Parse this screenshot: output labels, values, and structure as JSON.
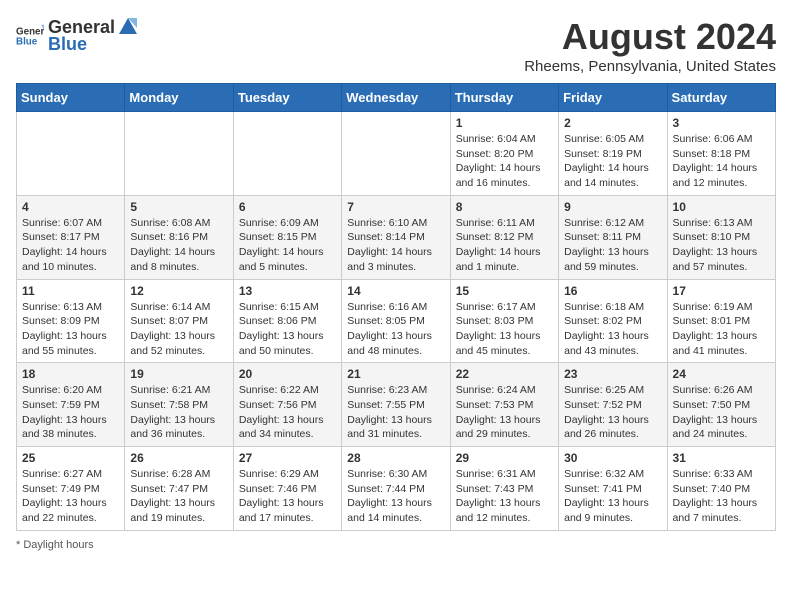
{
  "header": {
    "logo_general": "General",
    "logo_blue": "Blue",
    "month_year": "August 2024",
    "location": "Rheems, Pennsylvania, United States"
  },
  "days_of_week": [
    "Sunday",
    "Monday",
    "Tuesday",
    "Wednesday",
    "Thursday",
    "Friday",
    "Saturday"
  ],
  "weeks": [
    [
      {
        "day": "",
        "info": ""
      },
      {
        "day": "",
        "info": ""
      },
      {
        "day": "",
        "info": ""
      },
      {
        "day": "",
        "info": ""
      },
      {
        "day": "1",
        "info": "Sunrise: 6:04 AM\nSunset: 8:20 PM\nDaylight: 14 hours and 16 minutes."
      },
      {
        "day": "2",
        "info": "Sunrise: 6:05 AM\nSunset: 8:19 PM\nDaylight: 14 hours and 14 minutes."
      },
      {
        "day": "3",
        "info": "Sunrise: 6:06 AM\nSunset: 8:18 PM\nDaylight: 14 hours and 12 minutes."
      }
    ],
    [
      {
        "day": "4",
        "info": "Sunrise: 6:07 AM\nSunset: 8:17 PM\nDaylight: 14 hours and 10 minutes."
      },
      {
        "day": "5",
        "info": "Sunrise: 6:08 AM\nSunset: 8:16 PM\nDaylight: 14 hours and 8 minutes."
      },
      {
        "day": "6",
        "info": "Sunrise: 6:09 AM\nSunset: 8:15 PM\nDaylight: 14 hours and 5 minutes."
      },
      {
        "day": "7",
        "info": "Sunrise: 6:10 AM\nSunset: 8:14 PM\nDaylight: 14 hours and 3 minutes."
      },
      {
        "day": "8",
        "info": "Sunrise: 6:11 AM\nSunset: 8:12 PM\nDaylight: 14 hours and 1 minute."
      },
      {
        "day": "9",
        "info": "Sunrise: 6:12 AM\nSunset: 8:11 PM\nDaylight: 13 hours and 59 minutes."
      },
      {
        "day": "10",
        "info": "Sunrise: 6:13 AM\nSunset: 8:10 PM\nDaylight: 13 hours and 57 minutes."
      }
    ],
    [
      {
        "day": "11",
        "info": "Sunrise: 6:13 AM\nSunset: 8:09 PM\nDaylight: 13 hours and 55 minutes."
      },
      {
        "day": "12",
        "info": "Sunrise: 6:14 AM\nSunset: 8:07 PM\nDaylight: 13 hours and 52 minutes."
      },
      {
        "day": "13",
        "info": "Sunrise: 6:15 AM\nSunset: 8:06 PM\nDaylight: 13 hours and 50 minutes."
      },
      {
        "day": "14",
        "info": "Sunrise: 6:16 AM\nSunset: 8:05 PM\nDaylight: 13 hours and 48 minutes."
      },
      {
        "day": "15",
        "info": "Sunrise: 6:17 AM\nSunset: 8:03 PM\nDaylight: 13 hours and 45 minutes."
      },
      {
        "day": "16",
        "info": "Sunrise: 6:18 AM\nSunset: 8:02 PM\nDaylight: 13 hours and 43 minutes."
      },
      {
        "day": "17",
        "info": "Sunrise: 6:19 AM\nSunset: 8:01 PM\nDaylight: 13 hours and 41 minutes."
      }
    ],
    [
      {
        "day": "18",
        "info": "Sunrise: 6:20 AM\nSunset: 7:59 PM\nDaylight: 13 hours and 38 minutes."
      },
      {
        "day": "19",
        "info": "Sunrise: 6:21 AM\nSunset: 7:58 PM\nDaylight: 13 hours and 36 minutes."
      },
      {
        "day": "20",
        "info": "Sunrise: 6:22 AM\nSunset: 7:56 PM\nDaylight: 13 hours and 34 minutes."
      },
      {
        "day": "21",
        "info": "Sunrise: 6:23 AM\nSunset: 7:55 PM\nDaylight: 13 hours and 31 minutes."
      },
      {
        "day": "22",
        "info": "Sunrise: 6:24 AM\nSunset: 7:53 PM\nDaylight: 13 hours and 29 minutes."
      },
      {
        "day": "23",
        "info": "Sunrise: 6:25 AM\nSunset: 7:52 PM\nDaylight: 13 hours and 26 minutes."
      },
      {
        "day": "24",
        "info": "Sunrise: 6:26 AM\nSunset: 7:50 PM\nDaylight: 13 hours and 24 minutes."
      }
    ],
    [
      {
        "day": "25",
        "info": "Sunrise: 6:27 AM\nSunset: 7:49 PM\nDaylight: 13 hours and 22 minutes."
      },
      {
        "day": "26",
        "info": "Sunrise: 6:28 AM\nSunset: 7:47 PM\nDaylight: 13 hours and 19 minutes."
      },
      {
        "day": "27",
        "info": "Sunrise: 6:29 AM\nSunset: 7:46 PM\nDaylight: 13 hours and 17 minutes."
      },
      {
        "day": "28",
        "info": "Sunrise: 6:30 AM\nSunset: 7:44 PM\nDaylight: 13 hours and 14 minutes."
      },
      {
        "day": "29",
        "info": "Sunrise: 6:31 AM\nSunset: 7:43 PM\nDaylight: 13 hours and 12 minutes."
      },
      {
        "day": "30",
        "info": "Sunrise: 6:32 AM\nSunset: 7:41 PM\nDaylight: 13 hours and 9 minutes."
      },
      {
        "day": "31",
        "info": "Sunrise: 6:33 AM\nSunset: 7:40 PM\nDaylight: 13 hours and 7 minutes."
      }
    ]
  ],
  "footer": {
    "note": "Daylight hours"
  }
}
